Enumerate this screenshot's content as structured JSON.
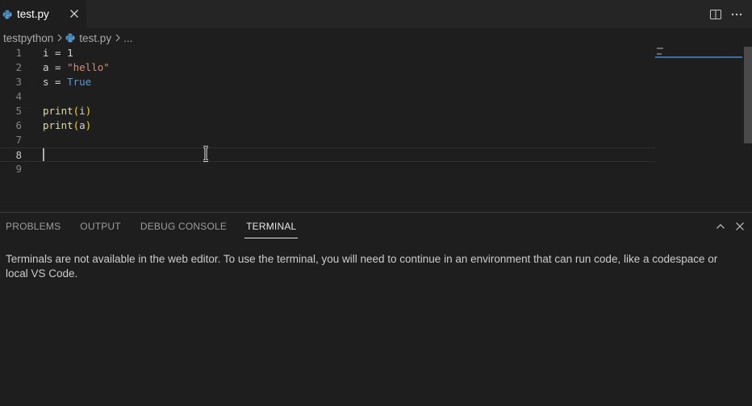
{
  "colors": {
    "editor_background": "#1e1e1e",
    "tabbar_background": "#252526",
    "string": "#ce9178",
    "keyword": "#569cd6",
    "function": "#dcdcaa",
    "bracket": "#ffd700",
    "line_number": "#858585",
    "minimap_highlight": "#3a6ea5"
  },
  "tab": {
    "icon": "python-icon",
    "label": "test.py",
    "close_icon": "close-icon"
  },
  "tab_actions": {
    "split_icon": "split-editor-icon",
    "more_icon": "more-actions-icon"
  },
  "breadcrumb": {
    "folder": "testpython",
    "file": "test.py",
    "more": "..."
  },
  "editor": {
    "current_line": 8,
    "lines": [
      {
        "number": "1",
        "tokens": [
          {
            "t": "var",
            "v": "i"
          },
          {
            "t": "pun",
            "v": " = "
          },
          {
            "t": "var",
            "v": "1"
          }
        ]
      },
      {
        "number": "2",
        "tokens": [
          {
            "t": "var",
            "v": "a"
          },
          {
            "t": "pun",
            "v": " = "
          },
          {
            "t": "str",
            "v": "\"hello\""
          }
        ]
      },
      {
        "number": "3",
        "tokens": [
          {
            "t": "var",
            "v": "s"
          },
          {
            "t": "pun",
            "v": " = "
          },
          {
            "t": "kw",
            "v": "True"
          }
        ]
      },
      {
        "number": "4",
        "tokens": []
      },
      {
        "number": "5",
        "tokens": [
          {
            "t": "fn",
            "v": "print"
          },
          {
            "t": "par",
            "v": "("
          },
          {
            "t": "var",
            "v": "i"
          },
          {
            "t": "par",
            "v": ")"
          }
        ]
      },
      {
        "number": "6",
        "tokens": [
          {
            "t": "fn",
            "v": "print"
          },
          {
            "t": "par",
            "v": "("
          },
          {
            "t": "var",
            "v": "a"
          },
          {
            "t": "par",
            "v": ")"
          }
        ]
      },
      {
        "number": "7",
        "tokens": []
      },
      {
        "number": "8",
        "tokens": []
      },
      {
        "number": "9",
        "tokens": []
      }
    ]
  },
  "panel": {
    "tabs": [
      {
        "label": "PROBLEMS",
        "active": false
      },
      {
        "label": "OUTPUT",
        "active": false
      },
      {
        "label": "DEBUG CONSOLE",
        "active": false
      },
      {
        "label": "TERMINAL",
        "active": true
      }
    ],
    "actions": {
      "maximize_icon": "chevron-up-icon",
      "close_icon": "close-icon"
    },
    "message": "Terminals are not available in the web editor. To use the terminal, you will need to continue in an environment that can run code, like a codespace or local VS Code."
  }
}
